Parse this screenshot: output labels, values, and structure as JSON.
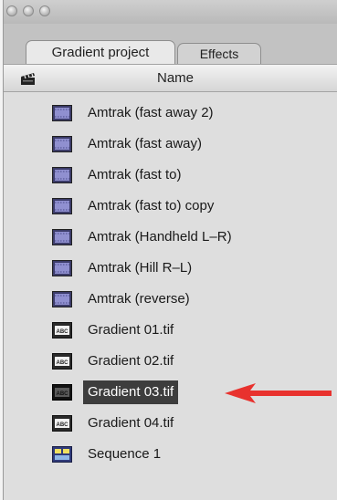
{
  "tabs": [
    {
      "label": "Gradient project",
      "active": true
    },
    {
      "label": "Effects",
      "active": false
    }
  ],
  "columns": {
    "name_header": "Name"
  },
  "items": [
    {
      "label": "Amtrak (fast away 2)",
      "icon": "clip-icon"
    },
    {
      "label": "Amtrak (fast away)",
      "icon": "clip-icon"
    },
    {
      "label": "Amtrak (fast to)",
      "icon": "clip-icon"
    },
    {
      "label": "Amtrak (fast to) copy",
      "icon": "clip-icon"
    },
    {
      "label": "Amtrak (Handheld L–R)",
      "icon": "clip-icon"
    },
    {
      "label": "Amtrak (Hill R–L)",
      "icon": "clip-icon"
    },
    {
      "label": "Amtrak (reverse)",
      "icon": "clip-icon"
    },
    {
      "label": "Gradient 01.tif",
      "icon": "still-image-icon"
    },
    {
      "label": "Gradient 02.tif",
      "icon": "still-image-icon"
    },
    {
      "label": "Gradient 03.tif",
      "icon": "still-image-icon",
      "selected": true
    },
    {
      "label": "Gradient 04.tif",
      "icon": "still-image-icon"
    },
    {
      "label": "Sequence 1",
      "icon": "sequence-icon"
    }
  ],
  "colors": {
    "arrow": "#e8322e",
    "selection": "#3d3d3d"
  }
}
